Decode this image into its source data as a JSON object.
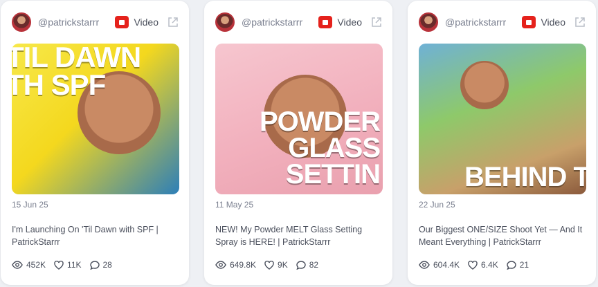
{
  "platform_icon": "youtube-icon",
  "accent": "#e5221c",
  "cards": [
    {
      "handle": "@patrickstarrr",
      "platform": "Video",
      "thumbnail_text": "TIL DAWN\nTH SPF",
      "date": "15 Jun 25",
      "title": "I'm Launching On 'Til Dawn with SPF | PatrickStarrr",
      "views": "452K",
      "likes": "11K",
      "comments": "28"
    },
    {
      "handle": "@patrickstarrr",
      "platform": "Video",
      "thumbnail_text": "POWDER\nGLASS SETTIN",
      "date": "11 May 25",
      "title": "NEW! My Powder MELT Glass Setting Spray is HERE! | PatrickStarrr",
      "views": "649.8K",
      "likes": "9K",
      "comments": "82"
    },
    {
      "handle": "@patrickstarrr",
      "platform": "Video",
      "thumbnail_text": "BEHIND THE SC",
      "date": "22 Jun 25",
      "title": "Our Biggest ONE/SIZE Shoot Yet — And It Meant Everything | PatrickStarrr",
      "views": "604.4K",
      "likes": "6.4K",
      "comments": "21"
    }
  ]
}
